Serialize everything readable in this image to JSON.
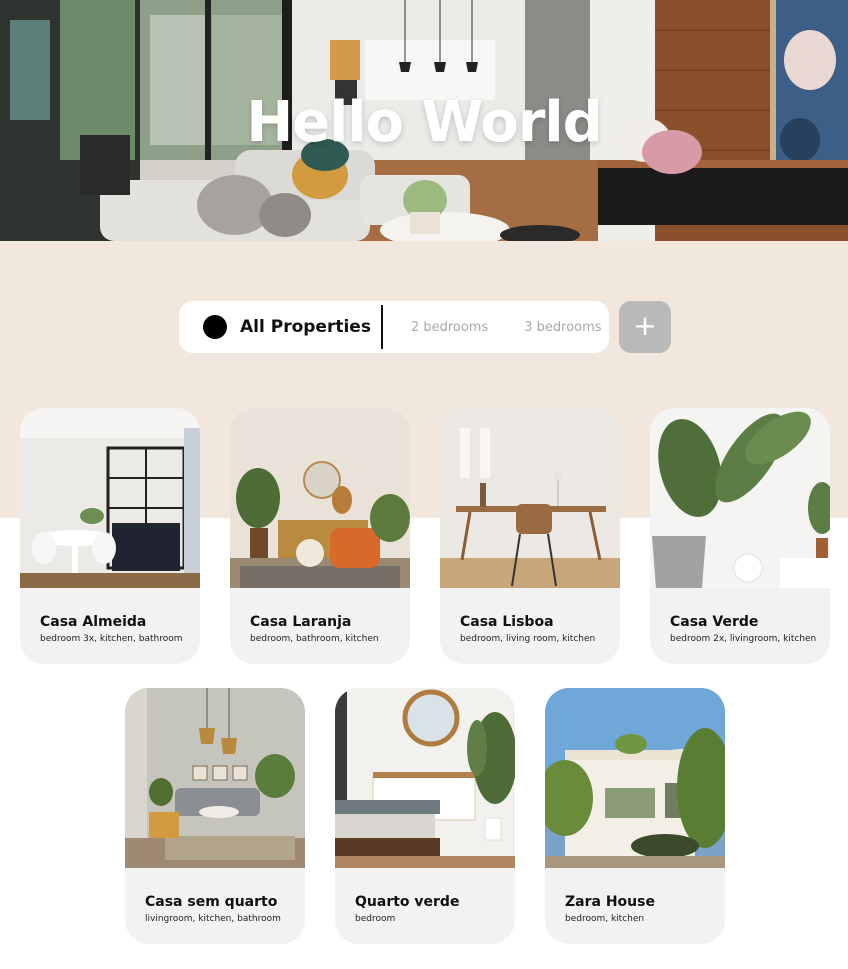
{
  "hero": {
    "title": "Hello World"
  },
  "filter": {
    "active_label": "All Properties",
    "options": [
      "2 bedrooms",
      "3 bedrooms"
    ],
    "add_label": "+"
  },
  "properties": [
    {
      "name": "Casa Almeida",
      "rooms": "bedroom 3x, kitchen, bathroom"
    },
    {
      "name": "Casa Laranja",
      "rooms": "bedroom, bathroom, kitchen"
    },
    {
      "name": "Casa Lisboa",
      "rooms": "bedroom, living room, kitchen"
    },
    {
      "name": "Casa Verde",
      "rooms": "bedroom 2x, livingroom, kitchen"
    },
    {
      "name": "Casa sem quarto",
      "rooms": "livingroom, kitchen, bathroom"
    },
    {
      "name": "Quarto verde",
      "rooms": "bedroom"
    },
    {
      "name": "Zara House",
      "rooms": "bedroom, kitchen"
    }
  ],
  "colors": {
    "beige": "#f1e7dc",
    "card": "#f2f2f2",
    "button": "#b9b9b9"
  }
}
